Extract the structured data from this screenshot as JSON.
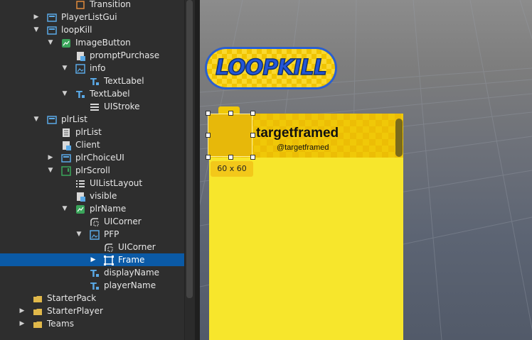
{
  "explorer": {
    "items": [
      {
        "label": "Transition",
        "icon": "transition-icon"
      },
      {
        "label": "PlayerListGui",
        "icon": "screengui-icon"
      },
      {
        "label": "loopKill",
        "icon": "screengui-icon"
      },
      {
        "label": "ImageButton",
        "icon": "imagebutton-icon"
      },
      {
        "label": "promptPurchase",
        "icon": "localscript-icon"
      },
      {
        "label": "info",
        "icon": "imagelabel-icon"
      },
      {
        "label": "TextLabel",
        "icon": "textlabel-icon"
      },
      {
        "label": "TextLabel",
        "icon": "textlabel-icon"
      },
      {
        "label": "UIStroke",
        "icon": "uistroke-icon"
      },
      {
        "label": "plrList",
        "icon": "screengui-icon"
      },
      {
        "label": "plrList",
        "icon": "script-icon"
      },
      {
        "label": "Client",
        "icon": "localscript-icon"
      },
      {
        "label": "plrChoiceUI",
        "icon": "screengui-icon"
      },
      {
        "label": "plrScroll",
        "icon": "scrollingframe-icon"
      },
      {
        "label": "UIListLayout",
        "icon": "uilistlayout-icon"
      },
      {
        "label": "visible",
        "icon": "localscript-icon"
      },
      {
        "label": "plrName",
        "icon": "imagebutton-icon"
      },
      {
        "label": "UICorner",
        "icon": "uicorner-icon"
      },
      {
        "label": "PFP",
        "icon": "imagelabel-icon"
      },
      {
        "label": "UICorner",
        "icon": "uicorner-icon"
      },
      {
        "label": "Frame",
        "icon": "frame-icon"
      },
      {
        "label": "displayName",
        "icon": "textlabel-icon"
      },
      {
        "label": "playerName",
        "icon": "textlabel-icon"
      },
      {
        "label": "StarterPack",
        "icon": "folder-icon"
      },
      {
        "label": "StarterPlayer",
        "icon": "folder-icon"
      },
      {
        "label": "Teams",
        "icon": "folder-icon"
      }
    ],
    "selected_index": 20
  },
  "viewport": {
    "loopkill_button_text": "LOOPKILL",
    "display_name": "targetframed",
    "player_name": "@targetframed",
    "selection_size": "60 x 60"
  },
  "colors": {
    "selection": "#0b5aa6",
    "panel_yellow": "#f7e62c",
    "button_blue": "#2356d8",
    "button_yellow": "#f0c400"
  }
}
